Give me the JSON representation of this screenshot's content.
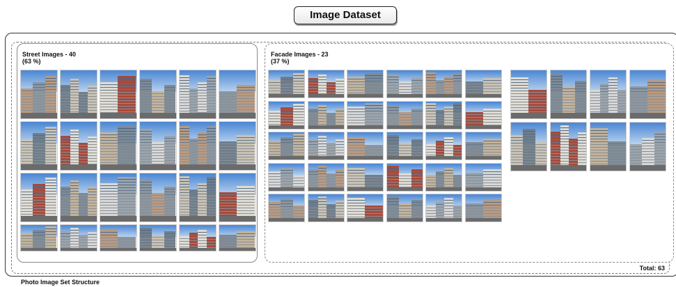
{
  "header": {
    "title": "Image Dataset"
  },
  "street": {
    "title": "Street Images - 40",
    "percent": "(63 %)",
    "count": 40
  },
  "facade": {
    "title": "Facade Images - 23",
    "percent": "(37 %)",
    "count": 23
  },
  "footer": {
    "total": "Total: 63",
    "caption": "Photo Image Set Structure"
  }
}
